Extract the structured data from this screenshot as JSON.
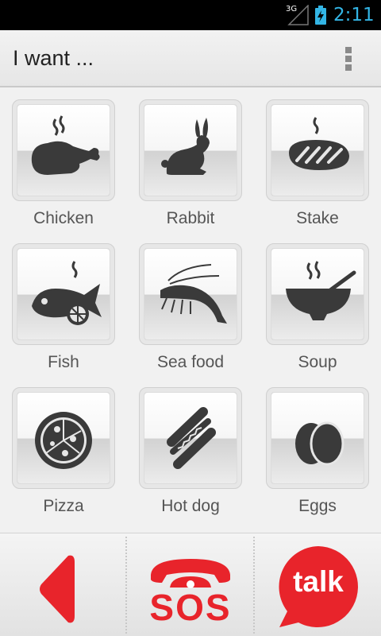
{
  "status_bar": {
    "network": "3G",
    "time": "2:11",
    "colors": {
      "accent": "#33b5e5",
      "background": "#000000"
    }
  },
  "action_bar": {
    "title": "I want ...",
    "menu_icon": "overflow-menu-icon"
  },
  "foods": [
    {
      "label": "Chicken",
      "icon": "chicken-icon"
    },
    {
      "label": "Rabbit",
      "icon": "rabbit-icon"
    },
    {
      "label": "Stake",
      "icon": "steak-icon"
    },
    {
      "label": "Fish",
      "icon": "fish-icon"
    },
    {
      "label": "Sea food",
      "icon": "shrimp-icon"
    },
    {
      "label": "Soup",
      "icon": "soup-icon"
    },
    {
      "label": "Pizza",
      "icon": "pizza-icon"
    },
    {
      "label": "Hot dog",
      "icon": "hot-dog-icon"
    },
    {
      "label": "Eggs",
      "icon": "eggs-icon"
    }
  ],
  "bottom_bar": {
    "back_icon": "back-arrow-icon",
    "sos": {
      "label": "SOS",
      "icon": "sos-phone-icon"
    },
    "talk": {
      "label": "talk",
      "icon": "talk-bubble-icon"
    },
    "colors": {
      "brand": "#e8242b",
      "icon": "#3a3a3a"
    }
  }
}
